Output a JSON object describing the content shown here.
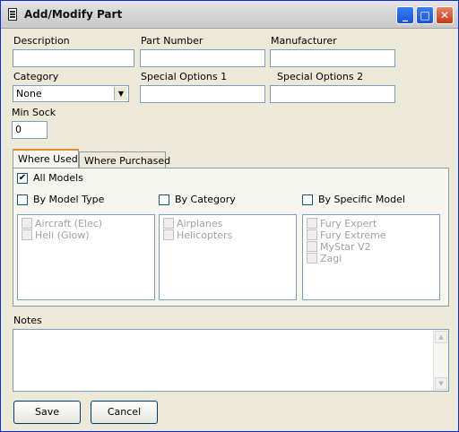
{
  "window": {
    "title": "Add/Modify Part",
    "min_symbol": "_",
    "max_symbol": "□",
    "close_symbol": "✕"
  },
  "fields": {
    "description_label": "Description",
    "part_number_label": "Part Number",
    "manufacturer_label": "Manufacturer",
    "category_label": "Category",
    "category_value": "None",
    "special1_label": "Special Options 1",
    "special2_label": "Special Options 2",
    "min_stock_label": "Min Sock",
    "min_stock_value": "0",
    "description_value": "",
    "part_number_value": "",
    "manufacturer_value": "",
    "special1_value": "",
    "special2_value": ""
  },
  "tabs": {
    "where_used": "Where Used",
    "where_purchased": "Where Purchased"
  },
  "where_used": {
    "all_models_label": "All Models",
    "all_models_checked": "✔",
    "by_model_type_label": "By Model Type",
    "by_category_label": "By Category",
    "by_specific_model_label": "By Specific Model",
    "model_types": [
      "Aircraft (Elec)",
      "Heli (Glow)"
    ],
    "categories": [
      "Airplanes",
      "Helicopters"
    ],
    "specific_models": [
      "Fury Expert",
      "Fury Extreme",
      "MyStar V2",
      "Zagi"
    ]
  },
  "notes": {
    "label": "Notes",
    "value": ""
  },
  "buttons": {
    "save": "Save",
    "cancel": "Cancel"
  },
  "colors": {
    "accent": "#0831d9",
    "tab_highlight": "#e68b2c",
    "disabled_text": "#a0a0a0"
  }
}
